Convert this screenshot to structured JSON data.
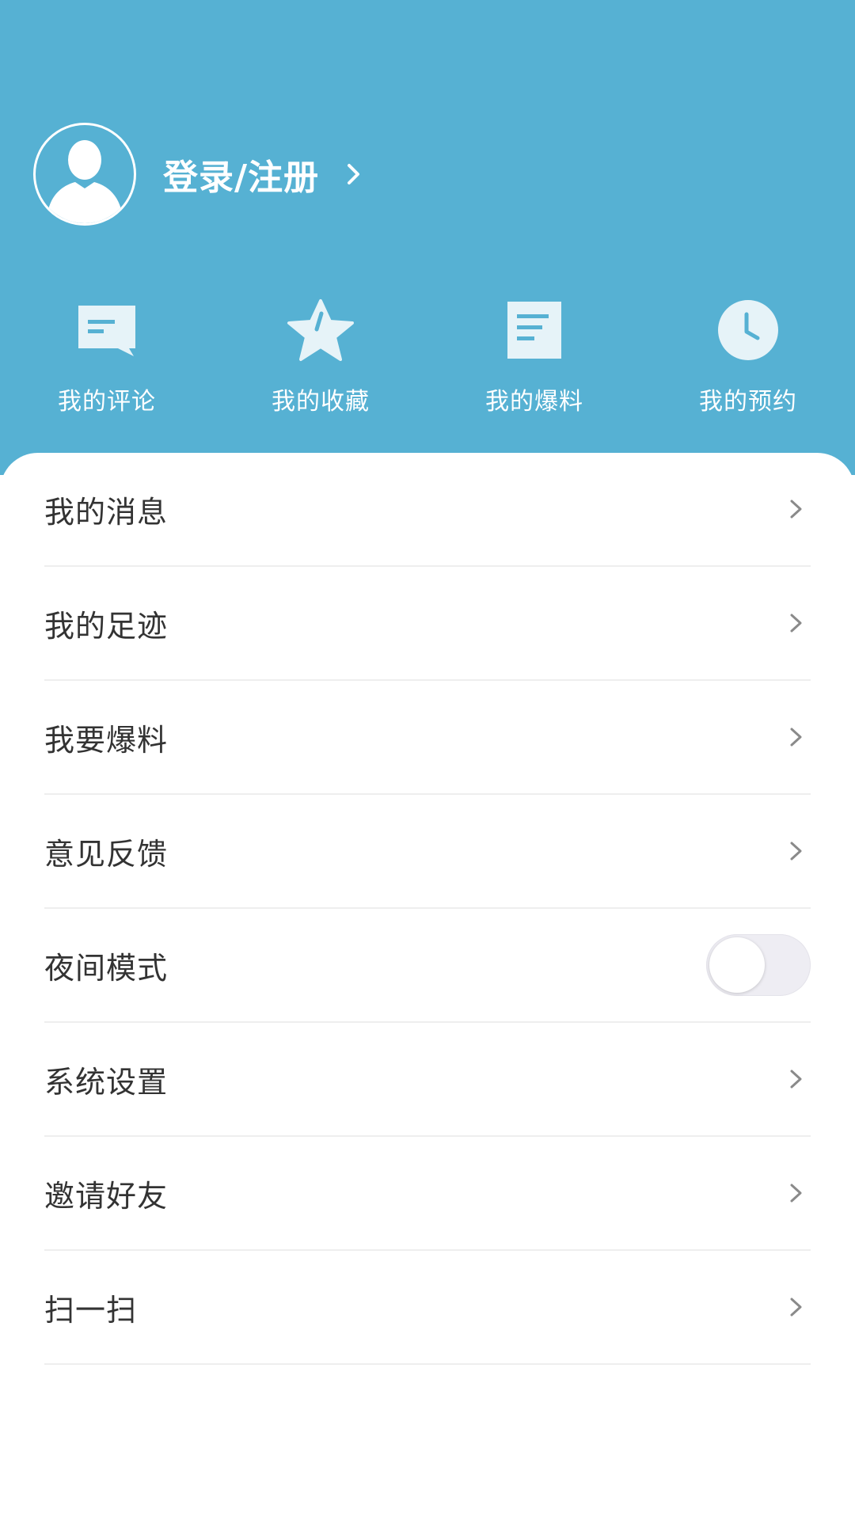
{
  "colors": {
    "header_bg": "#56b1d3",
    "icon_fill": "#e6f3f8",
    "menu_text": "#333333",
    "chevron": "#8a8a8a",
    "divider": "#eeeeee",
    "toggle_track": "#eeedf3"
  },
  "profile": {
    "avatar_icon": "default-user-avatar-icon",
    "login_label": "登录/注册",
    "chevron_icon": "chevron-right-icon"
  },
  "quick_actions": [
    {
      "label": "我的评论",
      "icon": "comment-icon"
    },
    {
      "label": "我的收藏",
      "icon": "star-icon"
    },
    {
      "label": "我的爆料",
      "icon": "document-icon"
    },
    {
      "label": "我的预约",
      "icon": "clock-icon"
    }
  ],
  "menu": [
    {
      "label": "我的消息",
      "control": "chevron"
    },
    {
      "label": "我的足迹",
      "control": "chevron"
    },
    {
      "label": "我要爆料",
      "control": "chevron"
    },
    {
      "label": "意见反馈",
      "control": "chevron"
    },
    {
      "label": "夜间模式",
      "control": "toggle",
      "toggle_on": false
    },
    {
      "label": "系统设置",
      "control": "chevron"
    },
    {
      "label": "邀请好友",
      "control": "chevron"
    },
    {
      "label": "扫一扫",
      "control": "chevron"
    }
  ]
}
